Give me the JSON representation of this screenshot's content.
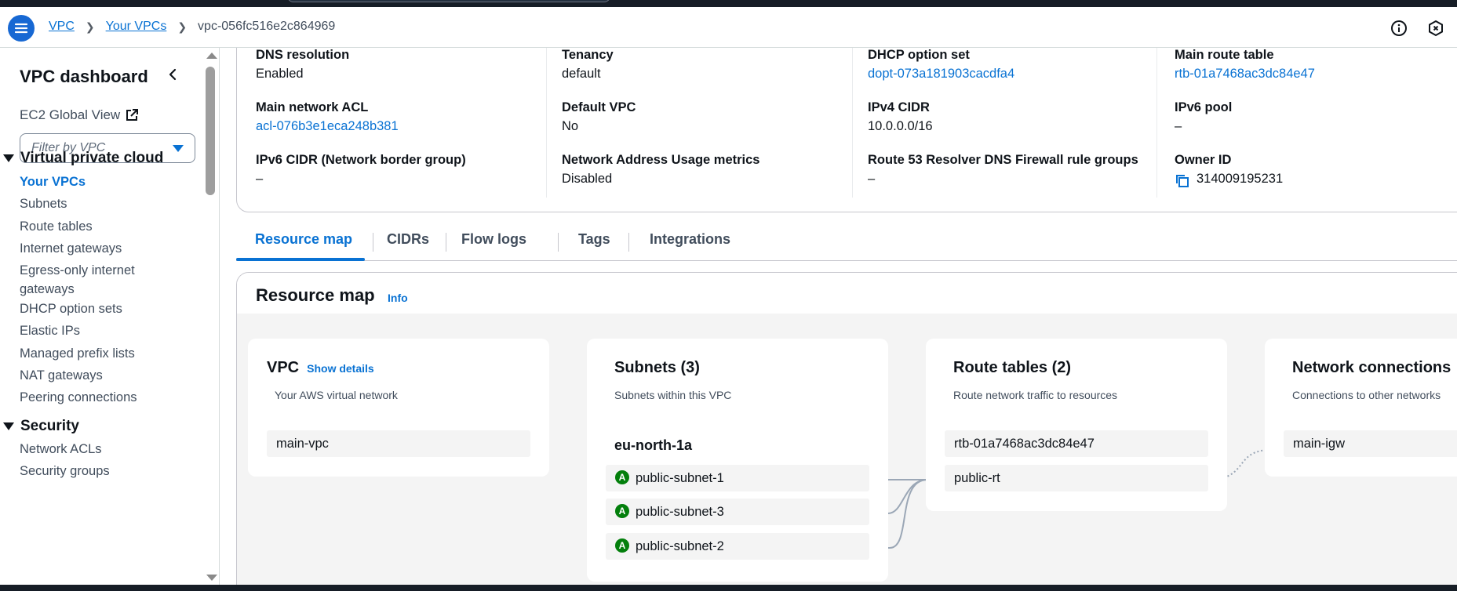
{
  "breadcrumb": {
    "items": [
      "VPC",
      "Your VPCs"
    ],
    "current": "vpc-056fc516e2c864969"
  },
  "sidebar": {
    "title": "VPC dashboard",
    "ec2_global_view": "EC2 Global View",
    "filter_placeholder": "Filter by VPC",
    "sections": [
      {
        "title": "Virtual private cloud",
        "items": [
          {
            "label": "Your VPCs",
            "active": true
          },
          {
            "label": "Subnets"
          },
          {
            "label": "Route tables"
          },
          {
            "label": "Internet gateways"
          },
          {
            "label": "Egress-only internet gateways"
          },
          {
            "label": "DHCP option sets"
          },
          {
            "label": "Elastic IPs"
          },
          {
            "label": "Managed prefix lists"
          },
          {
            "label": "NAT gateways"
          },
          {
            "label": "Peering connections"
          }
        ]
      },
      {
        "title": "Security",
        "items": [
          {
            "label": "Network ACLs"
          },
          {
            "label": "Security groups"
          }
        ]
      }
    ]
  },
  "details": {
    "dns_resolution": {
      "label": "DNS resolution",
      "value": "Enabled"
    },
    "tenancy": {
      "label": "Tenancy",
      "value": "default"
    },
    "dhcp_option_set": {
      "label": "DHCP option set",
      "value": "dopt-073a181903cacdfa4"
    },
    "main_route_table": {
      "label": "Main route table",
      "value": "rtb-01a7468ac3dc84e47"
    },
    "main_network_acl": {
      "label": "Main network ACL",
      "value": "acl-076b3e1eca248b381"
    },
    "default_vpc": {
      "label": "Default VPC",
      "value": "No"
    },
    "ipv4_cidr": {
      "label": "IPv4 CIDR",
      "value": "10.0.0.0/16"
    },
    "ipv6_pool": {
      "label": "IPv6 pool",
      "value": "–"
    },
    "ipv6_cidr": {
      "label": "IPv6 CIDR (Network border group)",
      "value": "–"
    },
    "nau_metrics": {
      "label": "Network Address Usage metrics",
      "value": "Disabled"
    },
    "route53_fw": {
      "label": "Route 53 Resolver DNS Firewall rule groups",
      "value": "–"
    },
    "owner_id": {
      "label": "Owner ID",
      "value": "314009195231"
    }
  },
  "tabs": [
    "Resource map",
    "CIDRs",
    "Flow logs",
    "Tags",
    "Integrations"
  ],
  "resource_map": {
    "title": "Resource map",
    "info": "Info",
    "vpc": {
      "title": "VPC",
      "link": "Show details",
      "subtitle": "Your AWS virtual network",
      "items": [
        "main-vpc"
      ]
    },
    "subnets": {
      "title": "Subnets (3)",
      "subtitle": "Subnets within this VPC",
      "az": "eu-north-1a",
      "status_letter": "A",
      "items": [
        "public-subnet-1",
        "public-subnet-3",
        "public-subnet-2"
      ]
    },
    "route_tables": {
      "title": "Route tables (2)",
      "subtitle": "Route network traffic to resources",
      "items": [
        "rtb-01a7468ac3dc84e47",
        "public-rt"
      ]
    },
    "network_connections": {
      "title": "Network connections",
      "subtitle": "Connections to other networks",
      "items": [
        "main-igw"
      ]
    }
  },
  "colors": {
    "accent": "#0972d3",
    "status_green": "#037f0c",
    "topbar": "#161d26"
  }
}
